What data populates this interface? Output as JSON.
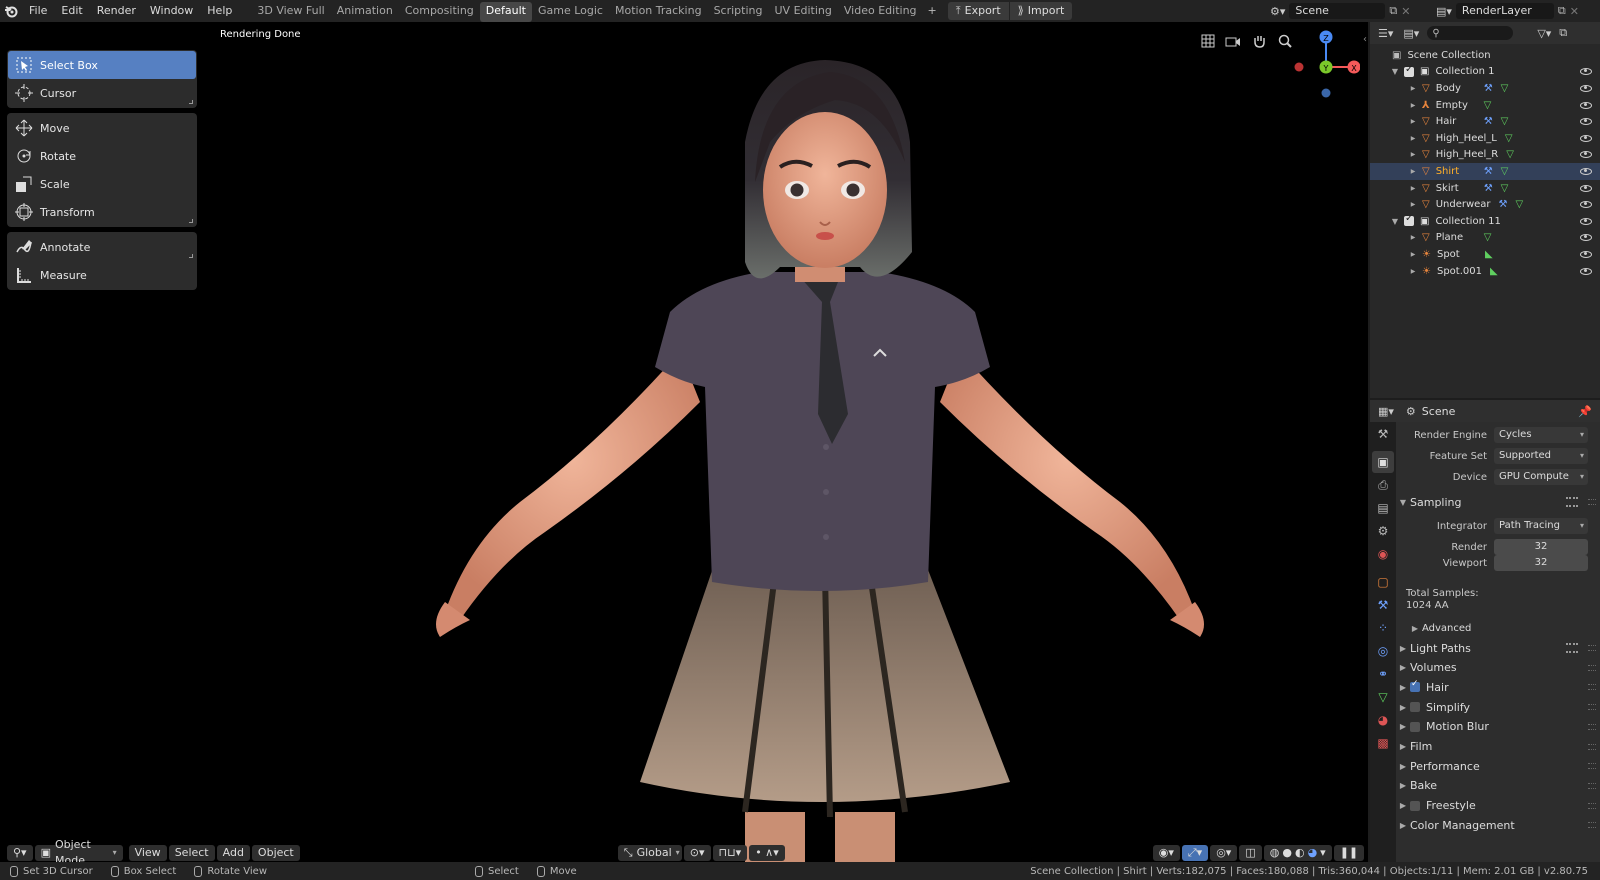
{
  "topbar": {
    "menus": [
      "File",
      "Edit",
      "Render",
      "Window",
      "Help"
    ],
    "workspaces": [
      "3D View Full",
      "Animation",
      "Compositing",
      "Default",
      "Game Logic",
      "Motion Tracking",
      "Scripting",
      "UV Editing",
      "Video Editing"
    ],
    "active_workspace": "Default",
    "add_workspace": "+",
    "export_label": "Export",
    "import_label": "Import",
    "scene_name": "Scene",
    "layer_name": "RenderLayer"
  },
  "viewport": {
    "status_text": "Rendering Done",
    "tools": [
      {
        "label": "Select Box",
        "icon": "select-box-icon",
        "active": true
      },
      {
        "label": "Cursor",
        "icon": "cursor-icon"
      },
      {
        "label": "Move",
        "icon": "move-icon"
      },
      {
        "label": "Rotate",
        "icon": "rotate-icon"
      },
      {
        "label": "Scale",
        "icon": "scale-icon"
      },
      {
        "label": "Transform",
        "icon": "transform-icon"
      },
      {
        "label": "Annotate",
        "icon": "annotate-icon"
      },
      {
        "label": "Measure",
        "icon": "measure-icon"
      }
    ],
    "gizmo": {
      "z": "Z",
      "y": "Y",
      "x": "X"
    },
    "header": {
      "mode": "Object Mode",
      "menus": [
        "View",
        "Select",
        "Add",
        "Object"
      ],
      "orientation": "Global"
    }
  },
  "statusbar": {
    "left": [
      {
        "label": "Set 3D Cursor"
      },
      {
        "label": "Box Select"
      },
      {
        "label": "Rotate View"
      },
      {
        "label": "Select"
      },
      {
        "label": "Move"
      }
    ],
    "stats": "Scene Collection | Shirt | Verts:182,075 | Faces:180,088 | Tris:360,044 | Objects:1/11 | Mem: 2.01 GB | v2.80.75"
  },
  "outliner": {
    "search_placeholder": "",
    "root": "Scene Collection",
    "collections": [
      {
        "name": "Collection 1",
        "items": [
          {
            "name": "Body",
            "type": "mesh",
            "modifier": true
          },
          {
            "name": "Empty",
            "type": "empty",
            "modifier": false
          },
          {
            "name": "Hair",
            "type": "mesh",
            "modifier": true
          },
          {
            "name": "High_Heel_L",
            "type": "mesh",
            "modifier": false
          },
          {
            "name": "High_Heel_R",
            "type": "mesh",
            "modifier": false
          },
          {
            "name": "Shirt",
            "type": "mesh",
            "modifier": true,
            "selected": true
          },
          {
            "name": "Skirt",
            "type": "mesh",
            "modifier": true
          },
          {
            "name": "Underwear",
            "type": "mesh",
            "modifier": true
          }
        ]
      },
      {
        "name": "Collection 11",
        "items": [
          {
            "name": "Plane",
            "type": "mesh",
            "modifier": false
          },
          {
            "name": "Spot",
            "type": "light",
            "modifier": false
          },
          {
            "name": "Spot.001",
            "type": "light",
            "modifier": false
          }
        ]
      }
    ]
  },
  "properties": {
    "context": "Scene",
    "render_engine_label": "Render Engine",
    "render_engine": "Cycles",
    "feature_set_label": "Feature Set",
    "feature_set": "Supported",
    "device_label": "Device",
    "device": "GPU Compute",
    "sampling": {
      "title": "Sampling",
      "integrator_label": "Integrator",
      "integrator": "Path Tracing",
      "render_label": "Render",
      "render": "32",
      "viewport_label": "Viewport",
      "viewport": "32",
      "total_label": "Total Samples:",
      "total_value": "1024 AA",
      "advanced": "Advanced"
    },
    "panels": [
      {
        "label": "Light Paths",
        "checkbox": null,
        "presets": true
      },
      {
        "label": "Volumes",
        "checkbox": null
      },
      {
        "label": "Hair",
        "checkbox": true
      },
      {
        "label": "Simplify",
        "checkbox": false
      },
      {
        "label": "Motion Blur",
        "checkbox": false
      },
      {
        "label": "Film",
        "checkbox": null
      },
      {
        "label": "Performance",
        "checkbox": null
      },
      {
        "label": "Bake",
        "checkbox": null
      },
      {
        "label": "Freestyle",
        "checkbox": false
      },
      {
        "label": "Color Management",
        "checkbox": null
      }
    ]
  },
  "colors": {
    "accent": "#5680c2",
    "selected_text": "#ffaf29",
    "mesh_icon": "#e8853d",
    "modifier_icon": "#6fa2ff",
    "data_icon": "#5fcf5f"
  }
}
